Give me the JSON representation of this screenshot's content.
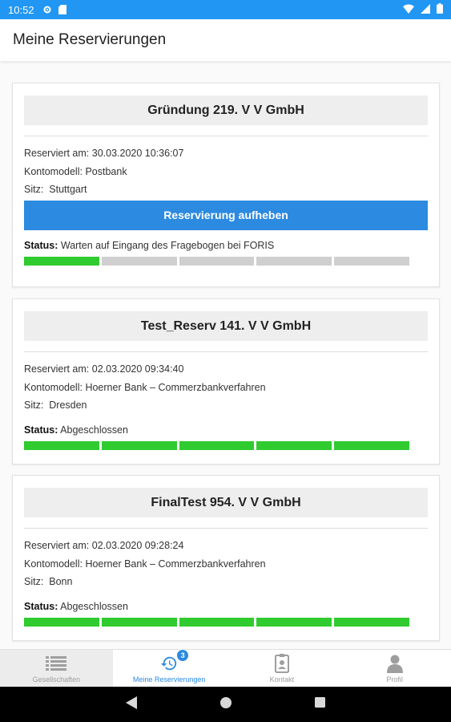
{
  "status_bar": {
    "time": "10:52"
  },
  "app_bar": {
    "title": "Meine Reservierungen"
  },
  "labels": {
    "reserviert": "Reserviert am:",
    "kontomodell": "Kontomodell:",
    "sitz": "Sitz:",
    "status": "Status:"
  },
  "reservations": [
    {
      "name": "Gründung 219. V V GmbH",
      "reserviert_am": "30.03.2020 10:36:07",
      "kontomodell": "Postbank",
      "sitz": "Stuttgart",
      "button_label": "Reservierung aufheben",
      "status_text": "Warten auf Eingang des Fragebogen bei FORIS",
      "progress_steps_done": 1,
      "progress_steps_total": 5
    },
    {
      "name": "Test_Reserv 141. V V GmbH",
      "reserviert_am": "02.03.2020 09:34:40",
      "kontomodell": "Hoerner Bank – Commerzbankverfahren",
      "sitz": "Dresden",
      "status_text": "Abgeschlossen",
      "progress_steps_done": 5,
      "progress_steps_total": 5
    },
    {
      "name": "FinalTest 954. V V GmbH",
      "reserviert_am": "02.03.2020 09:28:24",
      "kontomodell": "Hoerner Bank – Commerzbankverfahren",
      "sitz": "Bonn",
      "status_text": "Abgeschlossen",
      "progress_steps_done": 5,
      "progress_steps_total": 5
    }
  ],
  "bottom_nav": [
    {
      "label": "Gesellschaften",
      "icon": "list-icon",
      "active": false
    },
    {
      "label": "Meine Reservierungen",
      "icon": "history-icon",
      "active": true,
      "badge": "3"
    },
    {
      "label": "Kontakt",
      "icon": "contact-card-icon",
      "active": false
    },
    {
      "label": "Profil",
      "icon": "person-icon",
      "active": false
    }
  ],
  "colors": {
    "primary": "#2196f3",
    "button": "#2c8ae0",
    "progress_done": "#2fcb2f",
    "progress_todo": "#cfcfcf"
  }
}
